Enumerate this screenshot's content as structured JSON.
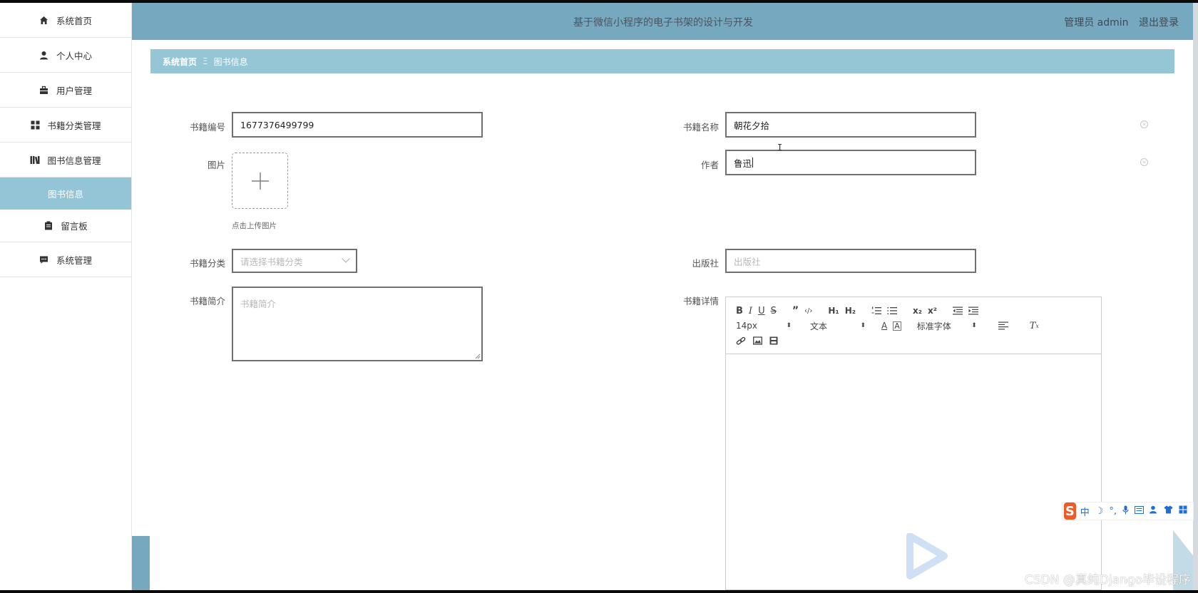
{
  "header": {
    "title": "基于微信小程序的电子书架的设计与开发",
    "user_label": "管理员 admin",
    "logout": "退出登录"
  },
  "sidebar": {
    "items": [
      {
        "label": "系统首页",
        "icon": "home-icon"
      },
      {
        "label": "个人中心",
        "icon": "user-icon"
      },
      {
        "label": "用户管理",
        "icon": "briefcase-icon"
      },
      {
        "label": "书籍分类管理",
        "icon": "grid-icon"
      },
      {
        "label": "图书信息管理",
        "icon": "books-icon"
      }
    ],
    "active_sub": "图书信息",
    "items_after": [
      {
        "label": "留言板",
        "icon": "clipboard-icon"
      },
      {
        "label": "系统管理",
        "icon": "chat-icon"
      }
    ]
  },
  "breadcrumb": {
    "home": "系统首页",
    "separator": "Ξ",
    "current": "图书信息"
  },
  "form": {
    "book_no_label": "书籍编号",
    "book_no_value": "1677376499799",
    "book_name_label": "书籍名称",
    "book_name_value": "朝花夕拾",
    "image_label": "图片",
    "upload_hint": "点击上传图片",
    "author_label": "作者",
    "author_value": "鲁迅",
    "category_label": "书籍分类",
    "category_placeholder": "请选择书籍分类",
    "publisher_label": "出版社",
    "publisher_placeholder": "出版社",
    "intro_label": "书籍简介",
    "intro_placeholder": "书籍简介",
    "detail_label": "书籍详情"
  },
  "editor": {
    "font_size": "14px",
    "paragraph": "文本",
    "font_family": "标准字体"
  },
  "ime": {
    "items": [
      "中",
      "☽",
      "°,",
      "🎤",
      "▦",
      "👤",
      "👕",
      "▦"
    ]
  },
  "watermark": "CSDN @真纯Django毕设程序"
}
